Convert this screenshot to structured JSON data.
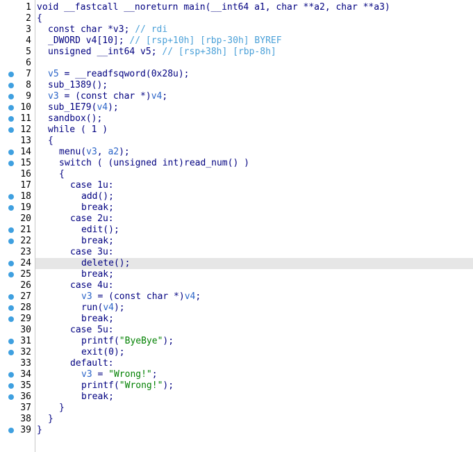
{
  "lines": [
    {
      "n": "1",
      "dot": false,
      "hl": false,
      "indent": 0,
      "tokens": [
        [
          "plain",
          "void __fastcall __noreturn main(__int64 a1, char **a2, char **a3)"
        ]
      ]
    },
    {
      "n": "2",
      "dot": false,
      "hl": false,
      "indent": 0,
      "tokens": [
        [
          "plain",
          "{"
        ]
      ]
    },
    {
      "n": "3",
      "dot": false,
      "hl": false,
      "indent": 1,
      "tokens": [
        [
          "plain",
          "const char *v3; "
        ],
        [
          "comment",
          "// rdi"
        ]
      ]
    },
    {
      "n": "4",
      "dot": false,
      "hl": false,
      "indent": 1,
      "tokens": [
        [
          "plain",
          "_DWORD v4[10]; "
        ],
        [
          "comment",
          "// [rsp+10h] [rbp-30h] BYREF"
        ]
      ]
    },
    {
      "n": "5",
      "dot": false,
      "hl": false,
      "indent": 1,
      "tokens": [
        [
          "plain",
          "unsigned __int64 v5; "
        ],
        [
          "comment",
          "// [rsp+38h] [rbp-8h]"
        ]
      ]
    },
    {
      "n": "6",
      "dot": false,
      "hl": false,
      "indent": 0,
      "tokens": []
    },
    {
      "n": "7",
      "dot": true,
      "hl": false,
      "indent": 1,
      "tokens": [
        [
          "var",
          "v5"
        ],
        [
          "plain",
          " = __readfsqword(0x28u);"
        ]
      ]
    },
    {
      "n": "8",
      "dot": true,
      "hl": false,
      "indent": 1,
      "tokens": [
        [
          "plain",
          "sub_1389();"
        ]
      ]
    },
    {
      "n": "9",
      "dot": true,
      "hl": false,
      "indent": 1,
      "tokens": [
        [
          "var",
          "v3"
        ],
        [
          "plain",
          " = (const char *)"
        ],
        [
          "var",
          "v4"
        ],
        [
          "plain",
          ";"
        ]
      ]
    },
    {
      "n": "10",
      "dot": true,
      "hl": false,
      "indent": 1,
      "tokens": [
        [
          "plain",
          "sub_1E79("
        ],
        [
          "var",
          "v4"
        ],
        [
          "plain",
          ");"
        ]
      ]
    },
    {
      "n": "11",
      "dot": true,
      "hl": false,
      "indent": 1,
      "tokens": [
        [
          "plain",
          "sandbox();"
        ]
      ]
    },
    {
      "n": "12",
      "dot": true,
      "hl": false,
      "indent": 1,
      "tokens": [
        [
          "plain",
          "while ( 1 )"
        ]
      ]
    },
    {
      "n": "13",
      "dot": false,
      "hl": false,
      "indent": 1,
      "tokens": [
        [
          "plain",
          "{"
        ]
      ]
    },
    {
      "n": "14",
      "dot": true,
      "hl": false,
      "indent": 2,
      "tokens": [
        [
          "plain",
          "menu("
        ],
        [
          "var",
          "v3"
        ],
        [
          "plain",
          ", "
        ],
        [
          "var",
          "a2"
        ],
        [
          "plain",
          ");"
        ]
      ]
    },
    {
      "n": "15",
      "dot": true,
      "hl": false,
      "indent": 2,
      "tokens": [
        [
          "plain",
          "switch ( (unsigned int)read_num() )"
        ]
      ]
    },
    {
      "n": "16",
      "dot": false,
      "hl": false,
      "indent": 2,
      "tokens": [
        [
          "plain",
          "{"
        ]
      ]
    },
    {
      "n": "17",
      "dot": false,
      "hl": false,
      "indent": 3,
      "tokens": [
        [
          "plain",
          "case 1u:"
        ]
      ]
    },
    {
      "n": "18",
      "dot": true,
      "hl": false,
      "indent": 4,
      "tokens": [
        [
          "plain",
          "add();"
        ]
      ]
    },
    {
      "n": "19",
      "dot": true,
      "hl": false,
      "indent": 4,
      "tokens": [
        [
          "plain",
          "break;"
        ]
      ]
    },
    {
      "n": "20",
      "dot": false,
      "hl": false,
      "indent": 3,
      "tokens": [
        [
          "plain",
          "case 2u:"
        ]
      ]
    },
    {
      "n": "21",
      "dot": true,
      "hl": false,
      "indent": 4,
      "tokens": [
        [
          "plain",
          "edit();"
        ]
      ]
    },
    {
      "n": "22",
      "dot": true,
      "hl": false,
      "indent": 4,
      "tokens": [
        [
          "plain",
          "break;"
        ]
      ]
    },
    {
      "n": "23",
      "dot": false,
      "hl": false,
      "indent": 3,
      "tokens": [
        [
          "plain",
          "case 3u:"
        ]
      ]
    },
    {
      "n": "24",
      "dot": true,
      "hl": true,
      "indent": 4,
      "tokens": [
        [
          "plain",
          "delete();"
        ]
      ]
    },
    {
      "n": "25",
      "dot": true,
      "hl": false,
      "indent": 4,
      "tokens": [
        [
          "plain",
          "break;"
        ]
      ]
    },
    {
      "n": "26",
      "dot": false,
      "hl": false,
      "indent": 3,
      "tokens": [
        [
          "plain",
          "case 4u:"
        ]
      ]
    },
    {
      "n": "27",
      "dot": true,
      "hl": false,
      "indent": 4,
      "tokens": [
        [
          "var",
          "v3"
        ],
        [
          "plain",
          " = (const char *)"
        ],
        [
          "var",
          "v4"
        ],
        [
          "plain",
          ";"
        ]
      ]
    },
    {
      "n": "28",
      "dot": true,
      "hl": false,
      "indent": 4,
      "tokens": [
        [
          "plain",
          "run("
        ],
        [
          "var",
          "v4"
        ],
        [
          "plain",
          ");"
        ]
      ]
    },
    {
      "n": "29",
      "dot": true,
      "hl": false,
      "indent": 4,
      "tokens": [
        [
          "plain",
          "break;"
        ]
      ]
    },
    {
      "n": "30",
      "dot": false,
      "hl": false,
      "indent": 3,
      "tokens": [
        [
          "plain",
          "case 5u:"
        ]
      ]
    },
    {
      "n": "31",
      "dot": true,
      "hl": false,
      "indent": 4,
      "tokens": [
        [
          "plain",
          "printf("
        ],
        [
          "str",
          "\"ByeBye\""
        ],
        [
          "plain",
          ");"
        ]
      ]
    },
    {
      "n": "32",
      "dot": true,
      "hl": false,
      "indent": 4,
      "tokens": [
        [
          "plain",
          "exit(0);"
        ]
      ]
    },
    {
      "n": "33",
      "dot": false,
      "hl": false,
      "indent": 3,
      "tokens": [
        [
          "plain",
          "default:"
        ]
      ]
    },
    {
      "n": "34",
      "dot": true,
      "hl": false,
      "indent": 4,
      "tokens": [
        [
          "var",
          "v3"
        ],
        [
          "plain",
          " = "
        ],
        [
          "str",
          "\"Wrong!\""
        ],
        [
          "plain",
          ";"
        ]
      ]
    },
    {
      "n": "35",
      "dot": true,
      "hl": false,
      "indent": 4,
      "tokens": [
        [
          "plain",
          "printf("
        ],
        [
          "str",
          "\"Wrong!\""
        ],
        [
          "plain",
          ");"
        ]
      ]
    },
    {
      "n": "36",
      "dot": true,
      "hl": false,
      "indent": 4,
      "tokens": [
        [
          "plain",
          "break;"
        ]
      ]
    },
    {
      "n": "37",
      "dot": false,
      "hl": false,
      "indent": 2,
      "tokens": [
        [
          "plain",
          "}"
        ]
      ]
    },
    {
      "n": "38",
      "dot": false,
      "hl": false,
      "indent": 1,
      "tokens": [
        [
          "plain",
          "}"
        ]
      ]
    },
    {
      "n": "39",
      "dot": true,
      "hl": false,
      "indent": 0,
      "tokens": [
        [
          "plain",
          "}"
        ]
      ]
    }
  ],
  "colors": {
    "breakpoint_dot": "#3fa0e0",
    "keyword_text": "#000080",
    "variable": "#2a64c8",
    "comment": "#4aa0d8",
    "string": "#008000",
    "highlight_line": "#e6e6e6"
  }
}
